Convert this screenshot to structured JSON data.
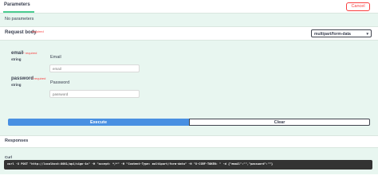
{
  "parameters": {
    "tab_label": "Parameters",
    "cancel_label": "Cancel",
    "empty_text": "No parameters"
  },
  "request_body": {
    "title": "Request body",
    "required_label": "required",
    "content_type": "multipart/form-data",
    "fields": [
      {
        "name": "email",
        "required_marker": "* required",
        "type": "string",
        "label": "Email",
        "placeholder": "email"
      },
      {
        "name": "password",
        "required_marker": "* required",
        "type": "string",
        "label": "Password",
        "placeholder": "password"
      }
    ]
  },
  "actions": {
    "execute_label": "Execute",
    "clear_label": "Clear"
  },
  "responses": {
    "title": "Responses",
    "curl_title": "Curl",
    "curl_command": "curl -X POST \"http://localhost:8081/api/sign-in\" -H \"accept: */*\" -H \"Content-Type: multipart/form-data\" -H \"X-CSRF-TOKEN: \" -d {\"email\":\"\",\"password\":\"\"}"
  },
  "colors": {
    "accent_green": "#49cc90",
    "block_background": "#e8f6f0",
    "execute_blue": "#4990e2",
    "cancel_red": "#f93e3e",
    "code_background": "#333333"
  }
}
